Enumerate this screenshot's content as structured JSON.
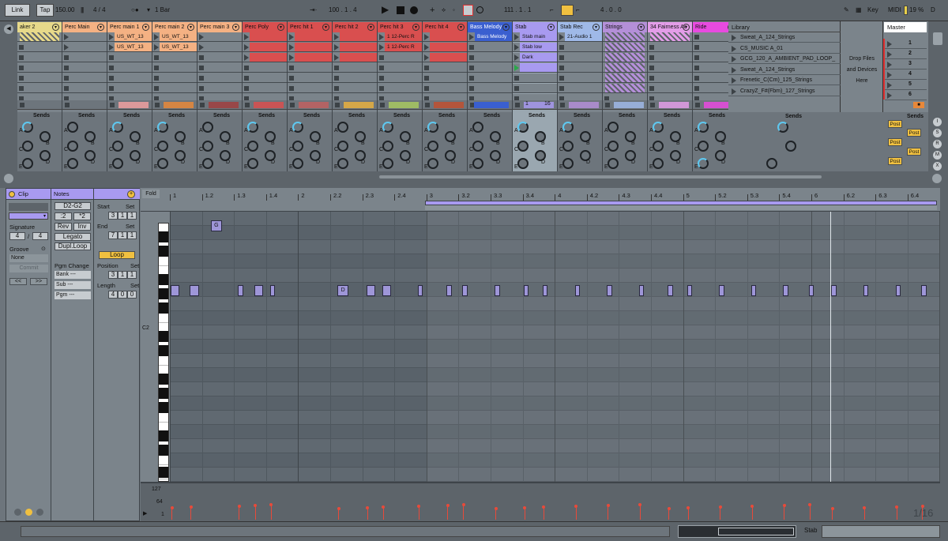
{
  "transport": {
    "link": "Link",
    "tap": "Tap",
    "tempo": "150.00",
    "sig": "4 / 4",
    "quant": "1 Bar",
    "position": "100 . 1 . 4",
    "loop_start": "111 . 1 . 1",
    "loop_len": "4 . 0 . 0",
    "key": "Key",
    "midi": "MIDI",
    "cpu": "19 %",
    "disk": "D"
  },
  "tracks": [
    {
      "name": "aker 2",
      "color": "#e7d98a"
    },
    {
      "name": "Perc Main",
      "color": "#f4b183"
    },
    {
      "name": "Perc main 1",
      "color": "#f4b183"
    },
    {
      "name": "Perc main 2",
      "color": "#f4b183"
    },
    {
      "name": "Perc main 3",
      "color": "#f4b183"
    },
    {
      "name": "Perc Poly",
      "color": "#d94f4f"
    },
    {
      "name": "Perc hit 1",
      "color": "#d94f4f"
    },
    {
      "name": "Perc hit 2",
      "color": "#d94f4f"
    },
    {
      "name": "Perc hit 3",
      "color": "#d94f4f"
    },
    {
      "name": "Perc hit 4",
      "color": "#d94f4f"
    },
    {
      "name": "Bass Melody",
      "color": "#3a5fd0"
    },
    {
      "name": "Stab",
      "color": "#a89af0"
    },
    {
      "name": "Stab Rec",
      "color": "#9fb9e8"
    },
    {
      "name": "Strings",
      "color": "#b48fd8"
    },
    {
      "name": "34 Fairness Ac",
      "color": "#e39de8"
    },
    {
      "name": "Ride",
      "color": "#e84ae0"
    }
  ],
  "clips": {
    "perc_main1_a": "US_WT_13",
    "perc_main1_b": "US_WT_13",
    "perc_main2_a": "US_WT_13",
    "perc_main2_b": "US_WT_13",
    "perc_hit3_a": "1 12-Perc R",
    "perc_hit3_b": "1 12-Perc R",
    "bass": "Bass Melody",
    "stab1": "Stab main",
    "stab2": "Stab low",
    "stab3": "Dark",
    "stabrec": "21-Audio 1",
    "stab_num1": "1",
    "stab_num2": "16"
  },
  "sends_label": "Sends",
  "knob_labels": {
    "a": "A",
    "b": "B",
    "c": "C",
    "d": "D",
    "e": "E"
  },
  "library": {
    "title": "Library",
    "items": [
      "Sweat_A_124_Strings",
      "CS_MUSIC A_01",
      "GCG_120_A_AMBIENT_PAD_LOOP_",
      "Sweat_A_124_Strings",
      "Frenetic_C(Cm)_125_Strings",
      "CrazyZ_F#(Fbm)_127_Strings"
    ]
  },
  "drop": {
    "line1": "Drop Files",
    "line2": "and Devices",
    "line3": "Here"
  },
  "master": {
    "title": "Master",
    "scenes": [
      "1",
      "2",
      "3",
      "4",
      "5",
      "6"
    ],
    "post": "Post"
  },
  "clipview": {
    "clip_title": "Clip",
    "notes_title": "Notes",
    "signature": "Signature",
    "sig_num": "4",
    "sig_den": "4",
    "groove": "Groove",
    "groove_val": "None",
    "commit": "Commit",
    "range": "D2-G2",
    "div": ":2",
    "mul": "*2",
    "rev": "Rev",
    "inv": "Inv",
    "legato": "Legato",
    "dupl": "Dupl.Loop",
    "pgm_change": "Pgm Change",
    "bank": "Bank ---",
    "sub": "Sub ---",
    "pgm": "Pgm ---",
    "start": "Start",
    "end": "End",
    "set": "Set",
    "start_val": [
      "3",
      "1",
      "1"
    ],
    "end_val": [
      "7",
      "1",
      "1"
    ],
    "loop": "Loop",
    "position": "Position",
    "pos_val": [
      "3",
      "1",
      "1"
    ],
    "length": "Length",
    "len_val": [
      "4",
      "0",
      "0"
    ]
  },
  "roll": {
    "fold": "Fold",
    "c2": "C2",
    "bars": [
      "1",
      "1.2",
      "1.3",
      "1.4",
      "2",
      "2.2",
      "2.3",
      "2.4",
      "3",
      "3.2",
      "3.3",
      "3.4",
      "4",
      "4.2",
      "4.3",
      "4.4",
      "5",
      "5.2",
      "5.3",
      "5.4",
      "6",
      "6.2",
      "6.3",
      "6.4"
    ],
    "note_g": "G",
    "note_d": "D",
    "vel_127": "127",
    "vel_64": "64",
    "vel_1": "1",
    "grid": "1/16"
  },
  "bottom": {
    "track": "Stab"
  }
}
